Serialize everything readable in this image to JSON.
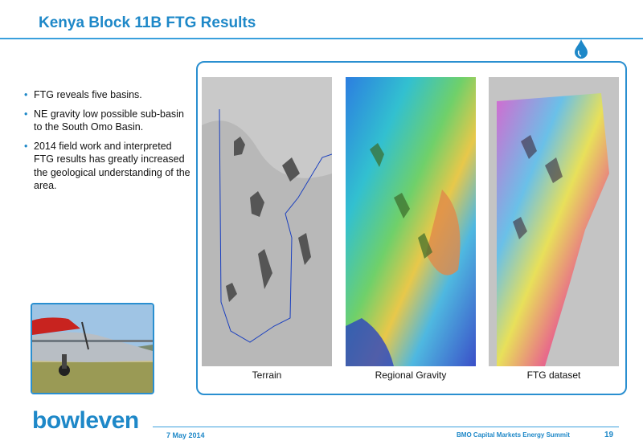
{
  "slide": {
    "title": "Kenya Block 11B FTG Results",
    "page_number": "19"
  },
  "bullets": [
    "FTG reveals five basins.",
    "NE gravity low possible sub-basin to the South Omo Basin.",
    "2014 field work and interpreted FTG results has greatly increased the geological understanding of the area."
  ],
  "maps": {
    "captions": [
      "Terrain",
      "Regional Gravity",
      "FTG dataset"
    ]
  },
  "footer": {
    "logo": "bowleven",
    "date": "7 May 2014",
    "event": "BMO Capital Markets Energy Summit"
  },
  "colors": {
    "accent": "#1e88c8",
    "frame": "#2a8fd0"
  }
}
